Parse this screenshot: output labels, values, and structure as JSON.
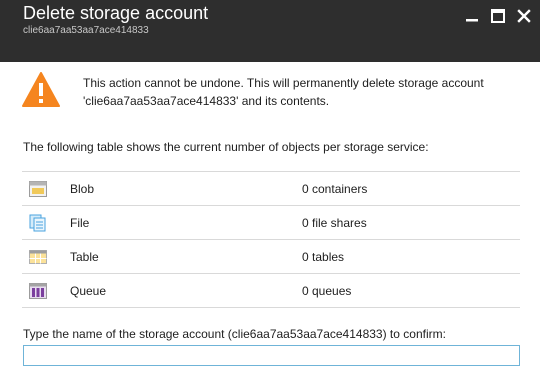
{
  "header": {
    "title": "Delete storage account",
    "subtitle": "clie6aa7aa53aa7ace414833",
    "controls": [
      "minimize-icon",
      "maximize-icon",
      "close-icon"
    ]
  },
  "warning": {
    "icon": "warning-icon",
    "color": "#f5851f",
    "message": "This action cannot be undone. This will permanently delete storage account 'clie6aa7aa53aa7ace414833' and its contents."
  },
  "table": {
    "intro": "The following table shows the current number of objects per storage service:",
    "rows": [
      {
        "icon": "blob-icon",
        "service": "Blob",
        "count": "0 containers"
      },
      {
        "icon": "file-icon",
        "service": "File",
        "count": "0 file shares"
      },
      {
        "icon": "table-icon",
        "service": "Table",
        "count": "0 tables"
      },
      {
        "icon": "queue-icon",
        "service": "Queue",
        "count": "0 queues"
      }
    ]
  },
  "confirm": {
    "label": "Type the name of the storage account (clie6aa7aa53aa7ace414833) to confirm:",
    "value": "",
    "placeholder": ""
  }
}
